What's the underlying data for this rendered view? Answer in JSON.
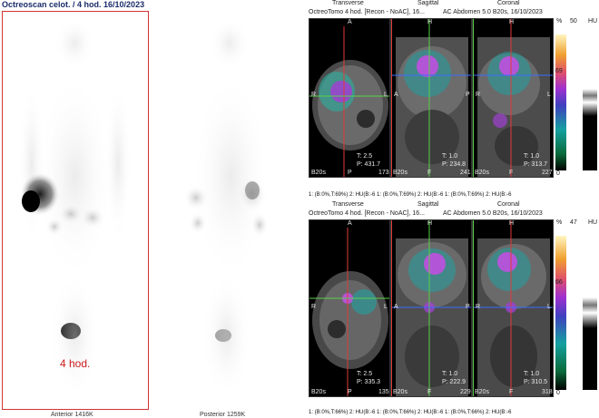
{
  "whole_body": {
    "title": "Octreoscan celot. / 4 hod. 16/10/2023",
    "anterior_caption": "Anterior 1416K",
    "posterior_caption": "Posterior 1259K",
    "time_label": "4 hod."
  },
  "spect_top": {
    "headers": {
      "transverse": "Transverse",
      "sagittal": "Sagittal",
      "coronal": "Coronal"
    },
    "series_line": "OctreoTomo 4 hod. [Recon - NoAC], 16...",
    "series_right": "AC Abdomen  5.0  B20s, 16/10/2023",
    "transverse": {
      "t": "T: 2.5",
      "p": "P: 431.7",
      "slice": "173",
      "name": "B20s",
      "letters": [
        "A",
        "R",
        "L",
        "P"
      ]
    },
    "sagittal": {
      "t": "T: 1.0",
      "p": "P: 234.8",
      "slice": "241",
      "name": "B20s",
      "letters": [
        "H",
        "A",
        "P",
        "F"
      ]
    },
    "coronal": {
      "t": "T: 1.0",
      "p": "P: 313.7",
      "slice": "227",
      "name": "B20s",
      "letters": [
        "H",
        "R",
        "L",
        "F"
      ]
    },
    "scale": {
      "pct_label": "%",
      "hu_label": "HU",
      "pct_max": "50",
      "pct_mid": "69",
      "pct_min": "0",
      "hu_val": ""
    },
    "footer": "1: (B:0%,T:69%)  2: HU(B:-6 1: (B:0%,T:69%)  2: HU(B:-6 1: (B:0%,T:69%)  2: HU(B:-6"
  },
  "spect_bottom": {
    "headers": {
      "transverse": "Transverse",
      "sagittal": "Sagittal",
      "coronal": "Coronal"
    },
    "series_line": "OctreoTomo 4 hod. [Recon - NoAC], 16...",
    "series_right": "AC Abdomen  5.0  B20s, 16/10/2023",
    "transverse": {
      "t": "T: 2.5",
      "p": "P: 335.3",
      "slice": "135",
      "name": "B20s",
      "letters": [
        "A",
        "R",
        "L",
        "P"
      ]
    },
    "sagittal": {
      "t": "T: 1.0",
      "p": "P: 222.9",
      "slice": "229",
      "name": "B20s",
      "letters": [
        "H",
        "A",
        "P",
        "F"
      ]
    },
    "coronal": {
      "t": "T: 1.0",
      "p": "P: 310.5",
      "slice": "318",
      "name": "B20s",
      "letters": [
        "H",
        "R",
        "L",
        "F"
      ]
    },
    "scale": {
      "pct_label": "%",
      "hu_label": "HU",
      "pct_max": "47",
      "pct_mid": "66",
      "pct_min": "0",
      "hu_val": ""
    },
    "footer": "1: (B:0%,T:66%)  2: HU(B:-6 1: (B:0%,T:66%)  2: HU(B:-6 1: (B:0%,T:66%)  2: HU(B:-6"
  },
  "colors": {
    "frame_red": "#d23232",
    "crosshair_green": "#5ad14a",
    "crosshair_blue": "#3b6cff",
    "crosshair_red": "#e03a3a"
  }
}
